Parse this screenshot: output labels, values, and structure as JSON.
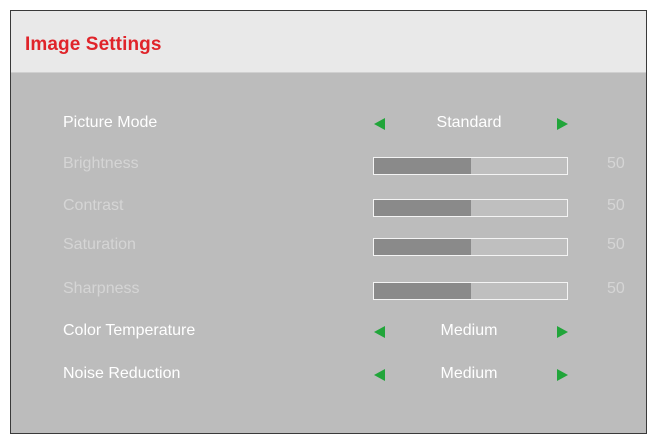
{
  "header": {
    "title": "Image Settings"
  },
  "settings": [
    {
      "label": "Picture Mode",
      "type": "select",
      "value": "Standard",
      "state": "active"
    },
    {
      "label": "Brightness",
      "type": "slider",
      "value": "50",
      "level": 0.5,
      "state": "disabled"
    },
    {
      "label": "Contrast",
      "type": "slider",
      "value": "50",
      "level": 0.5,
      "state": "disabled"
    },
    {
      "label": "Saturation",
      "type": "slider",
      "value": "50",
      "level": 0.5,
      "state": "disabled"
    },
    {
      "label": "Sharpness",
      "type": "slider",
      "value": "50",
      "level": 0.5,
      "state": "disabled"
    },
    {
      "label": "Color Temperature",
      "type": "select",
      "value": "Medium",
      "state": "active"
    },
    {
      "label": "Noise Reduction",
      "type": "select",
      "value": "Medium",
      "state": "active"
    }
  ],
  "icons": {
    "prev": "triangle-left-icon",
    "next": "triangle-right-icon"
  },
  "colors": {
    "title": "#e0242a",
    "arrow": "#21a53a",
    "background": "#bcbcbc",
    "header_background": "#e9e9e9",
    "slider_fill": "#8a8a8a"
  }
}
